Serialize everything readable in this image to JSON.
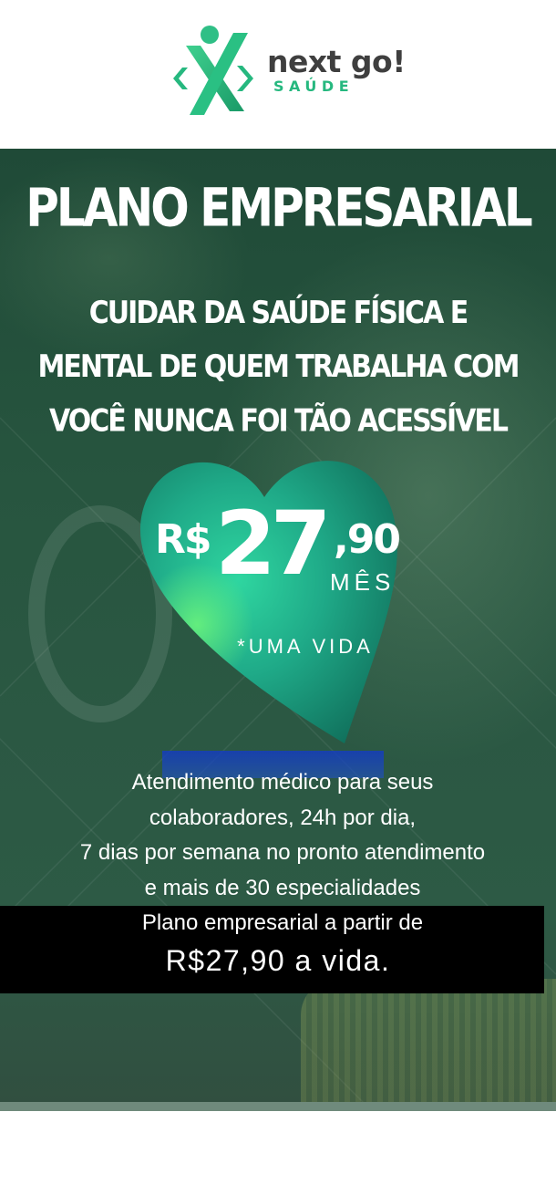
{
  "brand": {
    "name": "next go!",
    "subtitle": "SAÚDE",
    "colors": {
      "green": "#26b87f",
      "dark_green": "#1a9a67",
      "text": "#3f3f3f"
    }
  },
  "hero": {
    "title": "PLANO EMPRESARIAL",
    "subtitle_lines": [
      "CUIDAR DA SAÚDE FÍSICA E",
      "MENTAL DE QUEM TRABALHA COM",
      "VOCÊ NUNCA FOI TÃO ACESSÍVEL"
    ],
    "background_color": "#27553f"
  },
  "price": {
    "currency": "R$",
    "amount": "27",
    "cents": ",90",
    "period": "MÊS",
    "note": "*UMA VIDA",
    "heart_color": "#1faa88"
  },
  "description": {
    "lines": [
      "Atendimento médico para seus",
      "colaboradores, 24h por dia,",
      "7 dias por semana no pronto atendimento",
      "e mais de 30 especialidades",
      "Plano empresarial a partir de"
    ],
    "price_line": "R$27,90 a vida."
  }
}
